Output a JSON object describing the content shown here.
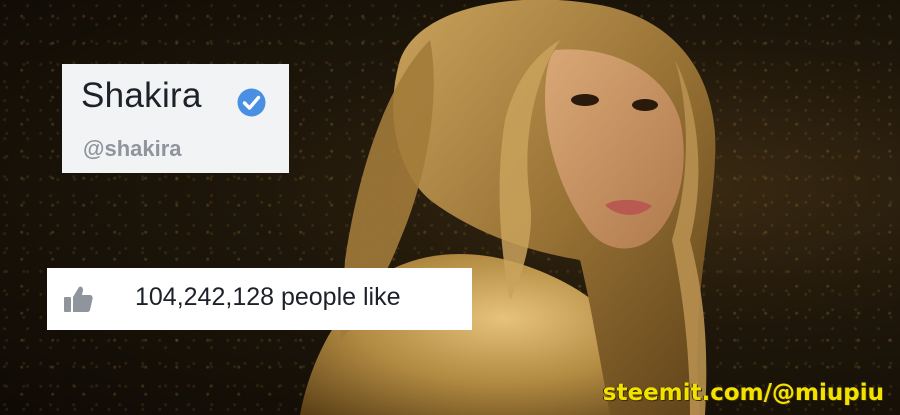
{
  "profile": {
    "name": "Shakira",
    "handle": "@shakira",
    "verified_icon": "verified-check-icon",
    "badge_color": "#4a90e2"
  },
  "likes": {
    "icon": "thumbs-up-icon",
    "text": "104,242,128 people like"
  },
  "watermark": {
    "text": "steemit.com/@miupiu",
    "color": "#f2e200"
  },
  "photo": {
    "subject": "woman with long blonde hair in gold body paint on a dark glittering background"
  }
}
